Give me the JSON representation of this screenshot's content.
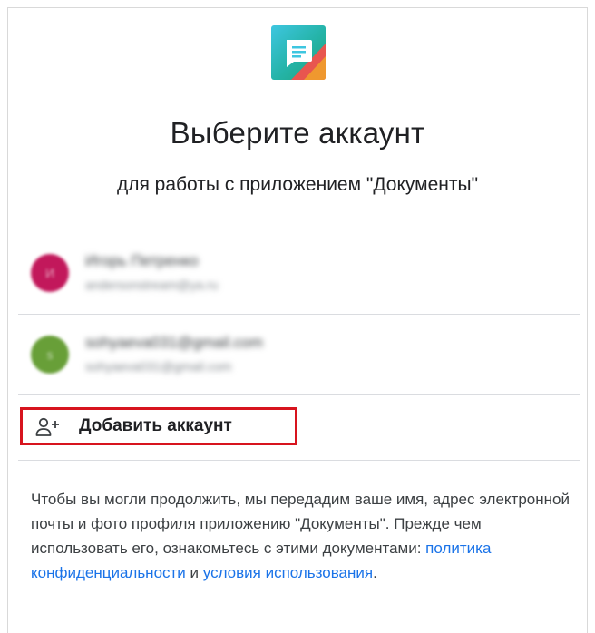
{
  "dialog": {
    "title": "Выберите аккаунт",
    "subtitle": "для работы с приложением \"Документы\""
  },
  "accounts": [
    {
      "name": "Игорь Петренко",
      "email": "andersonstream@ya.ru",
      "avatar_initial": "И",
      "avatar_color": "#c2185b"
    },
    {
      "name": "sohyaeva031@gmail.com",
      "email": "sohyaeva031@gmail.com",
      "avatar_initial": "s",
      "avatar_color": "#689f38"
    }
  ],
  "add_account": {
    "label": "Добавить аккаунт",
    "icon": "person-add-icon",
    "highlight_color": "#d7141e"
  },
  "disclaimer": {
    "text_before": "Чтобы вы могли продолжить, мы передадим ваше имя, адрес электронной почты и фото профиля приложению \"Документы\". Прежде чем использовать его, ознакомьтесь с этими документами: ",
    "privacy_link": "политика конфиденциальности",
    "conjunction": " и ",
    "terms_link": "условия использования",
    "text_after": "."
  },
  "colors": {
    "link": "#1a73e8",
    "text_primary": "#202124",
    "divider": "#dadce0"
  },
  "logo": {
    "icon": "google-docs-app-icon"
  }
}
